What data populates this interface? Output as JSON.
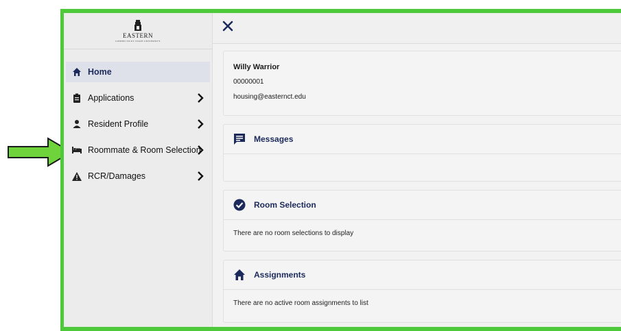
{
  "brand": {
    "logo_name": "EASTERN",
    "logo_sub": "CONNECTICUT STATE UNIVERSITY"
  },
  "nav": {
    "items": [
      {
        "label": "Home",
        "icon": "home-icon",
        "active": true
      },
      {
        "label": "Applications",
        "icon": "clipboard-icon"
      },
      {
        "label": "Resident Profile",
        "icon": "person-icon"
      },
      {
        "label": "Roommate & Room Selection",
        "icon": "bed-icon"
      },
      {
        "label": "RCR/Damages",
        "icon": "warning-icon"
      }
    ]
  },
  "profile": {
    "name": "Willy Warrior",
    "id": "00000001",
    "email": "housing@easternct.edu"
  },
  "sections": {
    "messages": {
      "title": "Messages",
      "body": ""
    },
    "room_selection": {
      "title": "Room Selection",
      "body": "There are no room selections to display"
    },
    "assignments": {
      "title": "Assignments",
      "body": "There are no active room assignments to list"
    }
  },
  "colors": {
    "frame": "#4ec93a",
    "navy": "#1b2a5a",
    "arrow": "#6fd43c"
  }
}
